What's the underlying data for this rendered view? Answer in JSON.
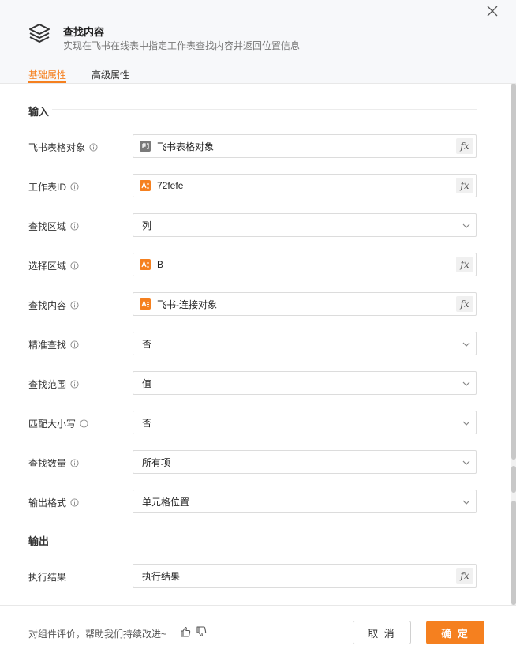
{
  "header": {
    "title": "查找内容",
    "subtitle": "实现在飞书在线表中指定工作表查找内容并返回位置信息",
    "logo_icon": "layers-icon",
    "close_icon": "close-icon"
  },
  "tabs": [
    {
      "label": "基础属性",
      "active": true
    },
    {
      "label": "高级属性",
      "active": false
    }
  ],
  "sections": {
    "input": "输入",
    "output": "输出"
  },
  "fields": [
    {
      "label": "飞书表格对象",
      "type": "expression",
      "value": "飞书表格对象",
      "icon": "object-icon",
      "has_info": true
    },
    {
      "label": "工作表ID",
      "type": "expression",
      "value": "72fefe",
      "icon": "text-variable-icon",
      "has_info": true
    },
    {
      "label": "查找区域",
      "type": "select",
      "value": "列",
      "has_info": true
    },
    {
      "label": "选择区域",
      "type": "expression",
      "value": "B",
      "icon": "text-variable-icon",
      "has_info": true
    },
    {
      "label": "查找内容",
      "type": "expression",
      "value": "飞书-连接对象",
      "icon": "text-variable-icon",
      "has_info": true
    },
    {
      "label": "精准查找",
      "type": "select",
      "value": "否",
      "has_info": true
    },
    {
      "label": "查找范围",
      "type": "select",
      "value": "值",
      "has_info": true
    },
    {
      "label": "匹配大小写",
      "type": "select",
      "value": "否",
      "has_info": true
    },
    {
      "label": "查找数量",
      "type": "select",
      "value": "所有项",
      "has_info": true
    },
    {
      "label": "输出格式",
      "type": "select",
      "value": "单元格位置",
      "has_info": true
    }
  ],
  "output_fields": [
    {
      "label": "执行结果",
      "type": "expression",
      "value": "执行结果",
      "has_info": false
    }
  ],
  "fx_label": "fx",
  "footer": {
    "feedback_text": "对组件评价，帮助我们持续改进~",
    "cancel_label": "取 消",
    "confirm_label": "确 定"
  },
  "colors": {
    "accent": "#f5801f",
    "text_variable_icon": "#f5801f",
    "object_icon": "#7a7a7a"
  }
}
